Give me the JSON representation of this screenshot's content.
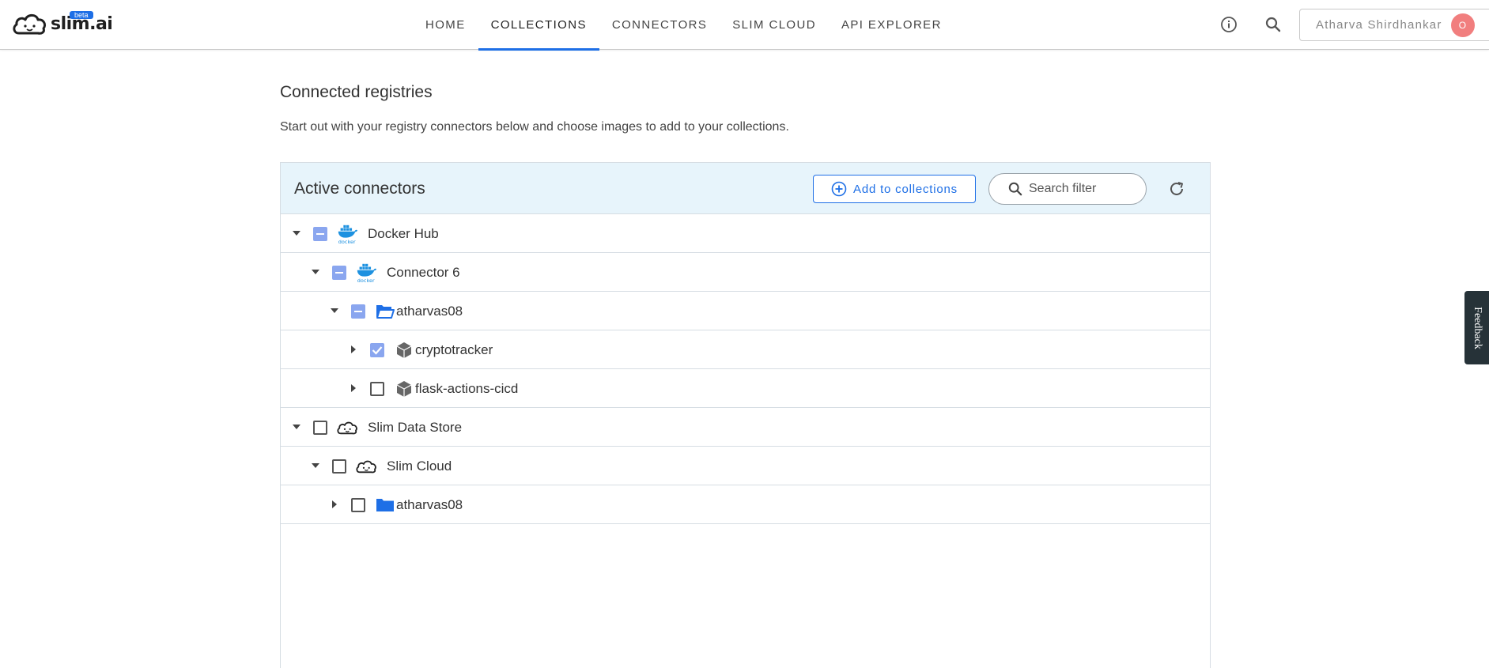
{
  "header": {
    "logo_text": "slim.ai",
    "beta": "beta",
    "nav": [
      {
        "label": "HOME"
      },
      {
        "label": "COLLECTIONS"
      },
      {
        "label": "CONNECTORS"
      },
      {
        "label": "SLIM CLOUD"
      },
      {
        "label": "API EXPLORER"
      }
    ],
    "active_nav": "COLLECTIONS",
    "user_name": "Atharva Shirdhankar",
    "avatar_initial": "O"
  },
  "page": {
    "title": "Connected registries",
    "subtitle": "Start out with your registry connectors below and choose images to add to your collections."
  },
  "panel": {
    "title": "Active connectors",
    "add_button": "Add to collections",
    "search_placeholder": "Search filter"
  },
  "tree": [
    {
      "label": "Docker Hub",
      "level": 0,
      "expanded": true,
      "check": "partial",
      "icon": "docker-icon"
    },
    {
      "label": "Connector 6",
      "level": 1,
      "expanded": true,
      "check": "partial",
      "icon": "docker-icon"
    },
    {
      "label": "atharvas08",
      "level": 2,
      "expanded": true,
      "check": "partial",
      "icon": "folder-open-icon"
    },
    {
      "label": "cryptotracker",
      "level": 3,
      "expanded": false,
      "check": "checked",
      "icon": "package-icon"
    },
    {
      "label": "flask-actions-cicd",
      "level": 3,
      "expanded": false,
      "check": "empty",
      "icon": "package-icon"
    },
    {
      "label": "Slim Data Store",
      "level": 0,
      "expanded": true,
      "check": "empty",
      "icon": "slim-cloud-icon"
    },
    {
      "label": "Slim Cloud",
      "level": 1,
      "expanded": true,
      "check": "empty",
      "icon": "slim-cloud-icon"
    },
    {
      "label": "atharvas08",
      "level": 2,
      "expanded": false,
      "check": "empty",
      "icon": "folder-icon"
    }
  ],
  "feedback": "Feedback",
  "colors": {
    "accent": "#1e6fe6",
    "checkbox": "#8aa6ef",
    "panel_header": "#e7f4fb"
  }
}
